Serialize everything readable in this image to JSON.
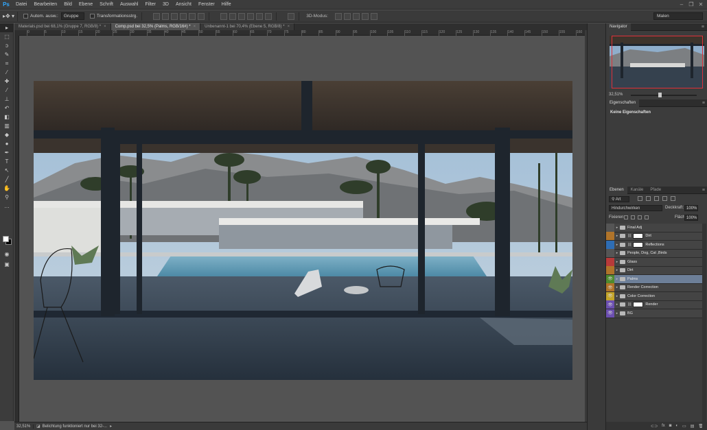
{
  "app": {
    "logo": "Ps",
    "accent_color": "#31a8ff"
  },
  "menu": [
    "Datei",
    "Bearbeiten",
    "Bild",
    "Ebene",
    "Schrift",
    "Auswahl",
    "Filter",
    "3D",
    "Ansicht",
    "Fenster",
    "Hilfe"
  ],
  "window_controls": [
    "–",
    "❐",
    "✕"
  ],
  "options_bar": {
    "auto_select_label": "Autom. ausw.:",
    "auto_select_value": "Gruppe",
    "transform_label": "Transformationsstrg.",
    "mode3d_label": "3D-Modus:",
    "workspace": "Malen"
  },
  "tabs": [
    {
      "label": "Materials.psd bei 68,1% (Gruppe 7, RGB/8) *",
      "active": false
    },
    {
      "label": "Comp.psd bei 32,5% (Palms, RGB/16#) *",
      "active": true
    },
    {
      "label": "Unbenannt-1 bei 70,4% (Ebene 5, RGB/8) *",
      "active": false
    }
  ],
  "ruler_ticks": [
    "0",
    "5",
    "10",
    "15",
    "20",
    "25",
    "30",
    "35",
    "40",
    "45",
    "50",
    "55",
    "60",
    "65",
    "70",
    "75",
    "80",
    "85",
    "90",
    "95",
    "100",
    "105",
    "110",
    "115",
    "120",
    "125",
    "130",
    "135",
    "140",
    "145",
    "150",
    "155",
    "160"
  ],
  "status": {
    "zoom": "32,51%",
    "message": "Belichtung funktioniert nur bei 32-..."
  },
  "navigator": {
    "tab": "Navigator",
    "zoom": "32,51%",
    "view_color": "#e0313a"
  },
  "properties": {
    "tab": "Eigenschaften",
    "body": "Keine Eigenschaften"
  },
  "layers_panel": {
    "tabs": [
      "Ebenen",
      "Kanäle",
      "Pfade"
    ],
    "filter": "Art",
    "blend_mode": "Hindurchwirken",
    "opacity_label": "Deckkraft:",
    "opacity_value": "100%",
    "lock_label": "Fixieren:",
    "fill_label": "Fläche:",
    "fill_value": "100%",
    "layers": [
      {
        "name": "Final Adj",
        "color": "#555555",
        "visible": false,
        "mask": false,
        "selected": false
      },
      {
        "name": "Dirt",
        "color": "#b0742a",
        "visible": false,
        "mask": true,
        "selected": false
      },
      {
        "name": "Reflections",
        "color": "#2e6db4",
        "visible": false,
        "mask": true,
        "selected": false
      },
      {
        "name": "People, Dog, Cat ,Birds",
        "color": "#555555",
        "visible": false,
        "mask": false,
        "selected": false
      },
      {
        "name": "Glass",
        "color": "#b83a3a",
        "visible": false,
        "mask": false,
        "selected": false
      },
      {
        "name": "Dirt",
        "color": "#b0742a",
        "visible": false,
        "mask": false,
        "selected": false
      },
      {
        "name": "Palms",
        "color": "#4f8a2e",
        "visible": true,
        "mask": false,
        "selected": true
      },
      {
        "name": "Render Correction",
        "color": "#b0742a",
        "visible": true,
        "mask": false,
        "selected": false
      },
      {
        "name": "Color Correction",
        "color": "#c4a52a",
        "visible": true,
        "mask": false,
        "selected": false
      },
      {
        "name": "Render",
        "color": "#6c4fb0",
        "visible": true,
        "mask": true,
        "selected": false
      },
      {
        "name": "BG",
        "color": "#6c4fb0",
        "visible": true,
        "mask": false,
        "selected": false
      }
    ],
    "bottom_icons": [
      "⊂⊃",
      "fx",
      "◙",
      "◐",
      "▭",
      "▤",
      "🗑"
    ]
  }
}
